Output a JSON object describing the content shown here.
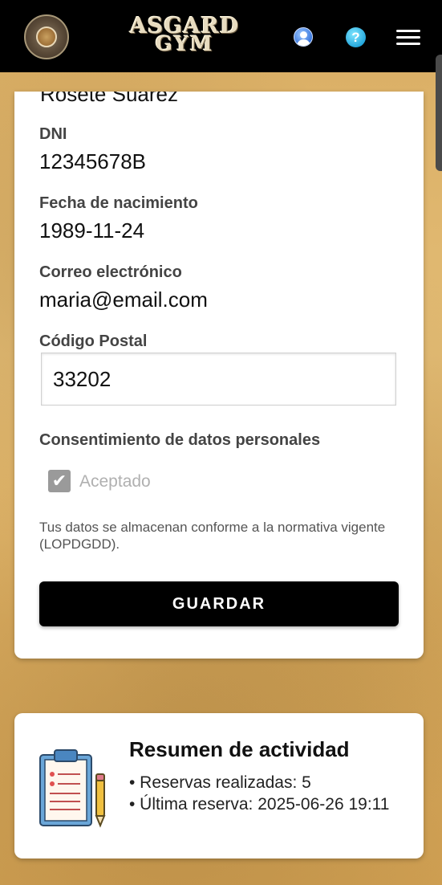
{
  "header": {
    "brand_line1": "ASGARD",
    "brand_line2": "GYM",
    "help_glyph": "?",
    "icons": [
      "logo-emblem-icon",
      "user-icon",
      "help-icon",
      "hamburger-menu-icon"
    ]
  },
  "profile": {
    "name_partial": "Rosete Suárez",
    "dni_label": "DNI",
    "dni_value": "12345678B",
    "birth_label": "Fecha de nacimiento",
    "birth_value": "1989-11-24",
    "email_label": "Correo electrónico",
    "email_value": "maria@email.com",
    "postal_label": "Código Postal",
    "postal_value": "33202",
    "consent_label": "Consentimiento de datos personales",
    "consent_checked_label": "Aceptado",
    "legal_note": "Tus datos se almacenan conforme a la normativa vigente (LOPDGDD).",
    "save_button": "GUARDAR"
  },
  "summary": {
    "title": "Resumen de actividad",
    "line1": "• Reservas realizadas: 5",
    "line2": "• Última reserva: 2025-06-26 19:11"
  },
  "colors": {
    "header_bg": "#000000",
    "button_bg": "#000000",
    "card_bg": "#ffffff",
    "checkbox": "#9a9a9a"
  }
}
